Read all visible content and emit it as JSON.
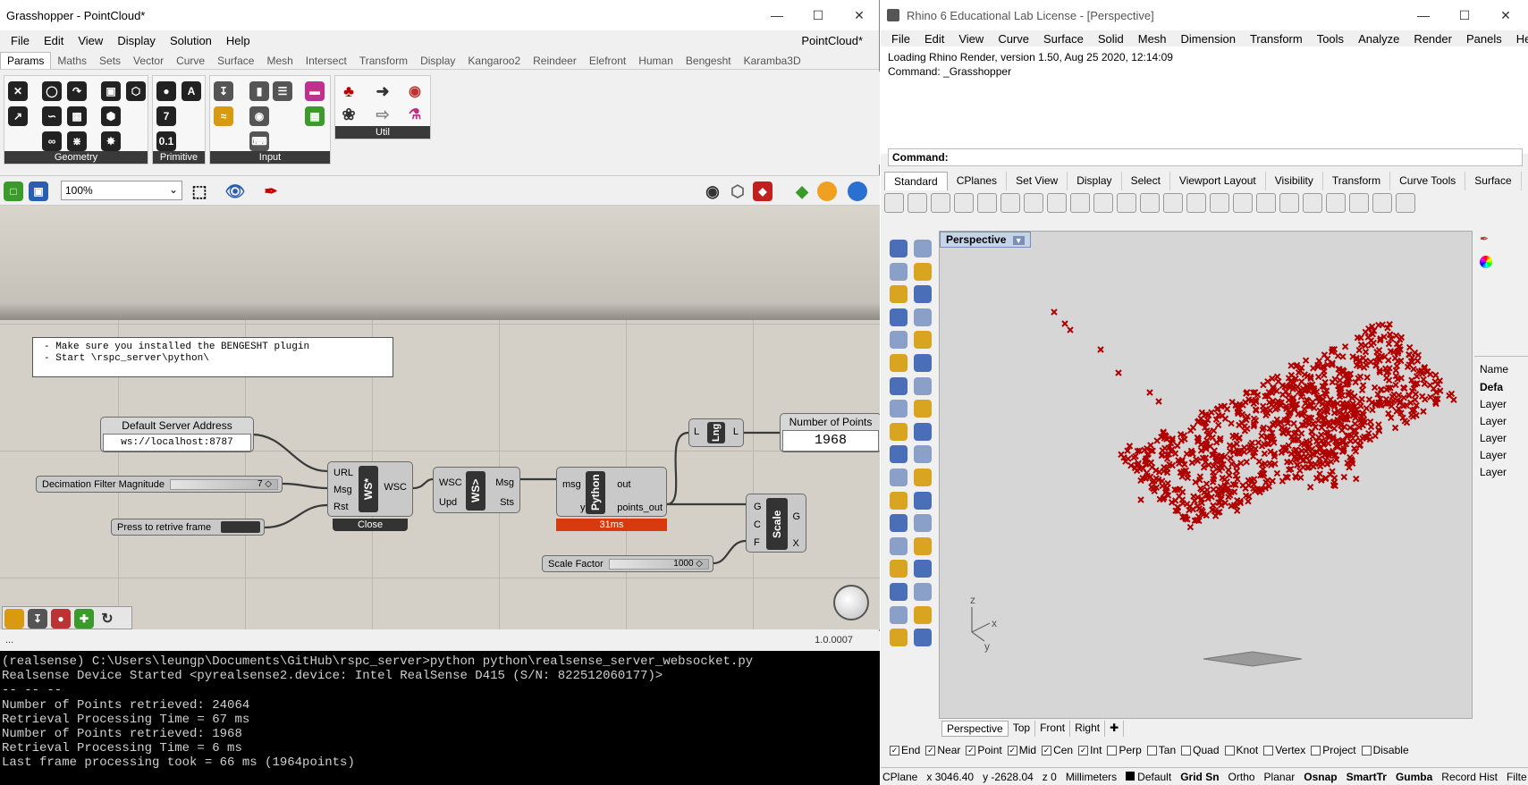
{
  "grasshopper": {
    "title": "Grasshopper - PointCloud*",
    "doc_name": "PointCloud*",
    "menu": [
      "File",
      "Edit",
      "View",
      "Display",
      "Solution",
      "Help"
    ],
    "tabs": [
      "Params",
      "Maths",
      "Sets",
      "Vector",
      "Curve",
      "Surface",
      "Mesh",
      "Intersect",
      "Transform",
      "Display",
      "Kangaroo2",
      "Reindeer",
      "Elefront",
      "Human",
      "Bengesht",
      "Karamba3D"
    ],
    "ribbon_groups": [
      "Geometry",
      "Primitive",
      "Input",
      "Util"
    ],
    "zoom": "100%",
    "version": "1.0.0007",
    "status_left": "...",
    "note_panel": [
      "- Make sure you installed the BENGESHT plugin",
      "- Start \\rspc_server\\python\\"
    ],
    "server_panel_title": "Default Server Address",
    "server_panel_value": "ws://localhost:8787",
    "decimation_label": "Decimation Filter Magnitude",
    "decimation_value": "7",
    "button_label": "Press to retrive frame",
    "ws_node": {
      "inputs": [
        "URL",
        "Msg",
        "Rst"
      ],
      "name": "WS*",
      "output": "WSC",
      "footer": "Close"
    },
    "wsr_node": {
      "inputs": [
        "WSC",
        "Upd"
      ],
      "name": "WS>",
      "outputs": [
        "Msg",
        "Sts"
      ]
    },
    "python_node": {
      "inputs": [
        "msg",
        "y"
      ],
      "name": "Python",
      "outputs": [
        "out",
        "points_out"
      ],
      "time": "31ms"
    },
    "lng_node": {
      "input": "L",
      "name": "Lng",
      "output": "L"
    },
    "count_panel_title": "Number of Points",
    "count_panel_value": "1968",
    "scale_node": {
      "inputs": [
        "G",
        "C",
        "F"
      ],
      "name": "Scale",
      "outputs": [
        "G",
        "X"
      ]
    },
    "scale_label": "Scale Factor",
    "scale_value": "1000"
  },
  "console": [
    "(realsense) C:\\Users\\leungp\\Documents\\GitHub\\rspc_server>python python\\realsense_server_websocket.py",
    "Realsense Device Started <pyrealsense2.device: Intel RealSense D415 (S/N: 822512060177)>",
    "-- -- --",
    "Number of Points retrieved: 24064",
    "Retrieval Processing Time = 67 ms",
    "Number of Points retrieved: 1968",
    "Retrieval Processing Time = 6 ms",
    "Last frame processing took =  66 ms (1964points)"
  ],
  "rhino": {
    "title": "Rhino 6 Educational Lab License - [Perspective]",
    "menu": [
      "File",
      "Edit",
      "View",
      "Curve",
      "Surface",
      "Solid",
      "Mesh",
      "Dimension",
      "Transform",
      "Tools",
      "Analyze",
      "Render",
      "Panels",
      "Help"
    ],
    "history": [
      "Loading Rhino Render, version 1.50, Aug 25 2020, 12:14:09",
      "Command: _Grasshopper"
    ],
    "command_label": "Command:",
    "toolbar_tabs": [
      "Standard",
      "CPlanes",
      "Set View",
      "Display",
      "Select",
      "Viewport Layout",
      "Visibility",
      "Transform",
      "Curve Tools",
      "Surface"
    ],
    "viewport_name": "Perspective",
    "view_tabs": [
      "Perspective",
      "Top",
      "Front",
      "Right"
    ],
    "layers_header": "Name",
    "layers": [
      "Defa",
      "Layer",
      "Layer",
      "Layer",
      "Layer",
      "Layer"
    ],
    "osnaps": [
      {
        "label": "End",
        "checked": true
      },
      {
        "label": "Near",
        "checked": true
      },
      {
        "label": "Point",
        "checked": true
      },
      {
        "label": "Mid",
        "checked": true
      },
      {
        "label": "Cen",
        "checked": true
      },
      {
        "label": "Int",
        "checked": true
      },
      {
        "label": "Perp",
        "checked": false
      },
      {
        "label": "Tan",
        "checked": false
      },
      {
        "label": "Quad",
        "checked": false
      },
      {
        "label": "Knot",
        "checked": false
      },
      {
        "label": "Vertex",
        "checked": false
      },
      {
        "label": "Project",
        "checked": false
      },
      {
        "label": "Disable",
        "checked": false
      }
    ],
    "status": [
      "CPlane",
      "x 3046.40",
      "y -2628.04",
      "z 0",
      "Millimeters",
      "Default",
      "Grid Sn",
      "Ortho",
      "Planar",
      "Osnap",
      "SmartTr",
      "Gumba",
      "Record Hist",
      "Filte"
    ],
    "axis_labels": [
      "z",
      "x",
      "y"
    ],
    "point_color": "#b00000"
  }
}
